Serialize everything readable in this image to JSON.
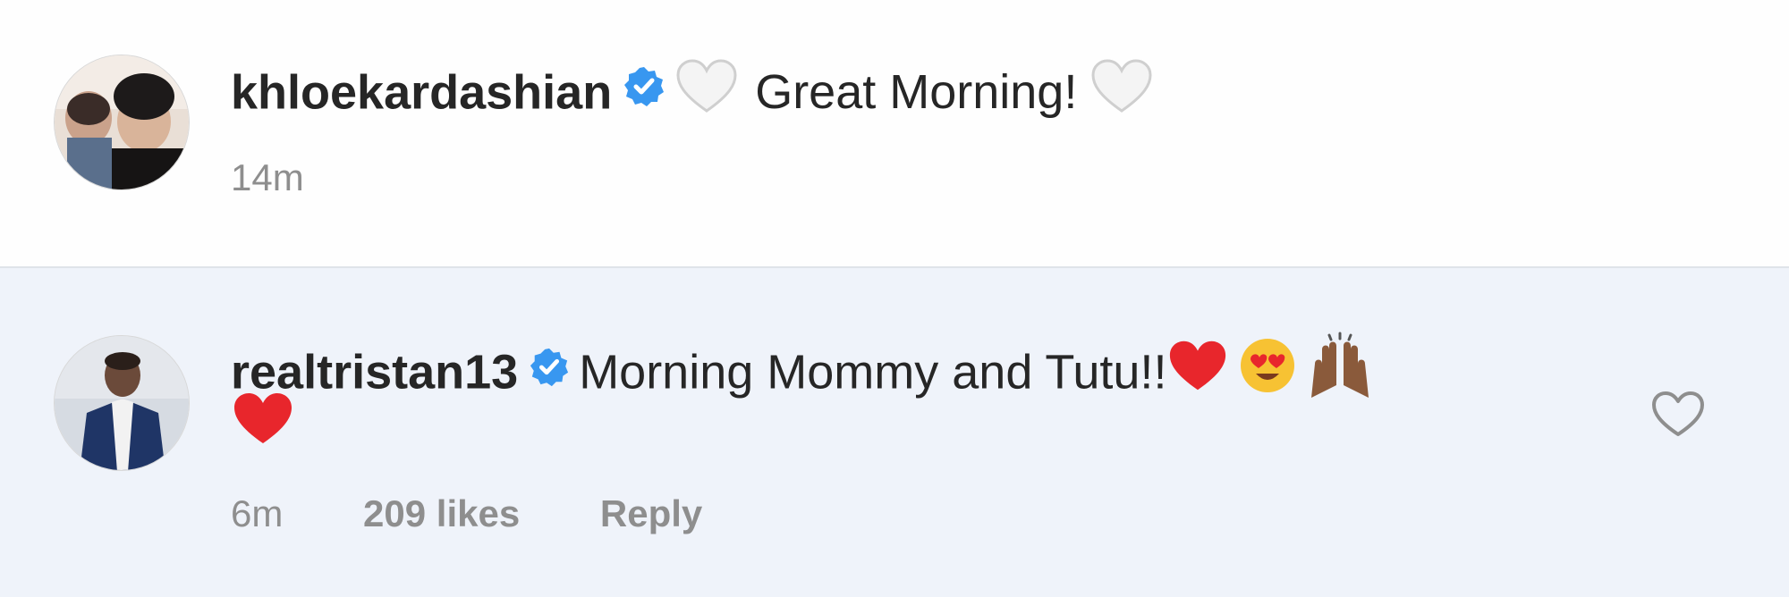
{
  "caption": {
    "username": "khloekardashian",
    "text": "Great Morning!",
    "time": "14m",
    "avatar_alt": "khloekardashian-avatar"
  },
  "comment": {
    "username": "realtristan13",
    "text": "Morning Mommy and Tutu!!",
    "time": "6m",
    "likes": "209 likes",
    "reply": "Reply"
  },
  "colors": {
    "verified_blue": "#3897f0",
    "meta_gray": "#8e8e8e",
    "comment_highlight": "#eff3fa",
    "red_heart": "#e8262c"
  },
  "icons": {
    "verified": "verified-badge-icon",
    "white_heart": "white-heart-emoji",
    "red_heart": "red-heart-emoji",
    "heart_eyes": "heart-eyes-emoji",
    "raised_hands": "raised-hands-emoji",
    "like": "heart-outline-icon"
  }
}
